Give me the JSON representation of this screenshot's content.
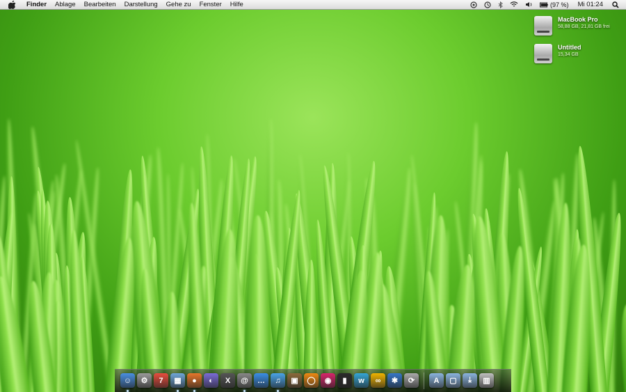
{
  "menubar": {
    "app_name": "Finder",
    "items": [
      "Ablage",
      "Bearbeiten",
      "Darstellung",
      "Gehe zu",
      "Fenster",
      "Hilfe"
    ],
    "battery_text": "(97 %)",
    "clock": "Mi 01:24",
    "status_icons": [
      "apple-logo",
      "spotlight",
      "time-machine",
      "bluetooth",
      "wifi",
      "volume",
      "battery"
    ]
  },
  "desktop": {
    "icons": [
      {
        "name": "MacBook Pro",
        "info": "58,88 GB, 21,81 GB frei"
      },
      {
        "name": "Untitled",
        "info": "15,34 GB"
      }
    ]
  },
  "dock": {
    "items": [
      {
        "icon": "finder-icon",
        "color": "#4a8fe0",
        "glyph": "☺",
        "running": true
      },
      {
        "icon": "system-preferences-icon",
        "color": "#9a9a9a",
        "glyph": "⚙",
        "running": false
      },
      {
        "icon": "ical-icon",
        "color": "#e84d3d",
        "glyph": "7",
        "running": false
      },
      {
        "icon": "preview-icon",
        "color": "#6fa6d8",
        "glyph": "▦",
        "running": true
      },
      {
        "icon": "firefox-icon",
        "color": "#e8762a",
        "glyph": "●",
        "running": true
      },
      {
        "icon": "ichat-icon",
        "color": "#7a6bd6",
        "glyph": "◐",
        "running": false
      },
      {
        "icon": "x11-icon",
        "color": "#555555",
        "glyph": "X",
        "running": false
      },
      {
        "icon": "adium-icon",
        "color": "#888888",
        "glyph": "@",
        "running": true
      },
      {
        "icon": "messages-icon",
        "color": "#3a8ee6",
        "glyph": "…",
        "running": false
      },
      {
        "icon": "itunes-icon",
        "color": "#4aa3e6",
        "glyph": "♫",
        "running": true
      },
      {
        "icon": "iphoto-icon",
        "color": "#8c6a3a",
        "glyph": "▣",
        "running": false
      },
      {
        "icon": "vlc-icon",
        "color": "#f08a12",
        "glyph": "◯",
        "running": false
      },
      {
        "icon": "shell-icon",
        "color": "#d8246a",
        "glyph": "◉",
        "running": false
      },
      {
        "icon": "dashboard-icon",
        "color": "#2a2a2a",
        "glyph": "▮",
        "running": false
      },
      {
        "icon": "word-icon",
        "color": "#35a6d6",
        "glyph": "w",
        "running": false
      },
      {
        "icon": "glasses-icon",
        "color": "#f0b400",
        "glyph": "∞",
        "running": false
      },
      {
        "icon": "bluetooth-icon",
        "color": "#3676c8",
        "glyph": "✱",
        "running": false
      },
      {
        "icon": "sync-icon",
        "color": "#aaaaaa",
        "glyph": "⟳",
        "running": false
      },
      {
        "icon": "applications-folder-icon",
        "color": "#8bb4de",
        "glyph": "A",
        "running": false
      },
      {
        "icon": "documents-folder-icon",
        "color": "#8bb4de",
        "glyph": "▢",
        "running": false
      },
      {
        "icon": "downloads-folder-icon",
        "color": "#8bb4de",
        "glyph": "⤓",
        "running": false
      },
      {
        "icon": "trash-icon",
        "color": "#bfbfbf",
        "glyph": "▥",
        "running": false
      }
    ]
  }
}
